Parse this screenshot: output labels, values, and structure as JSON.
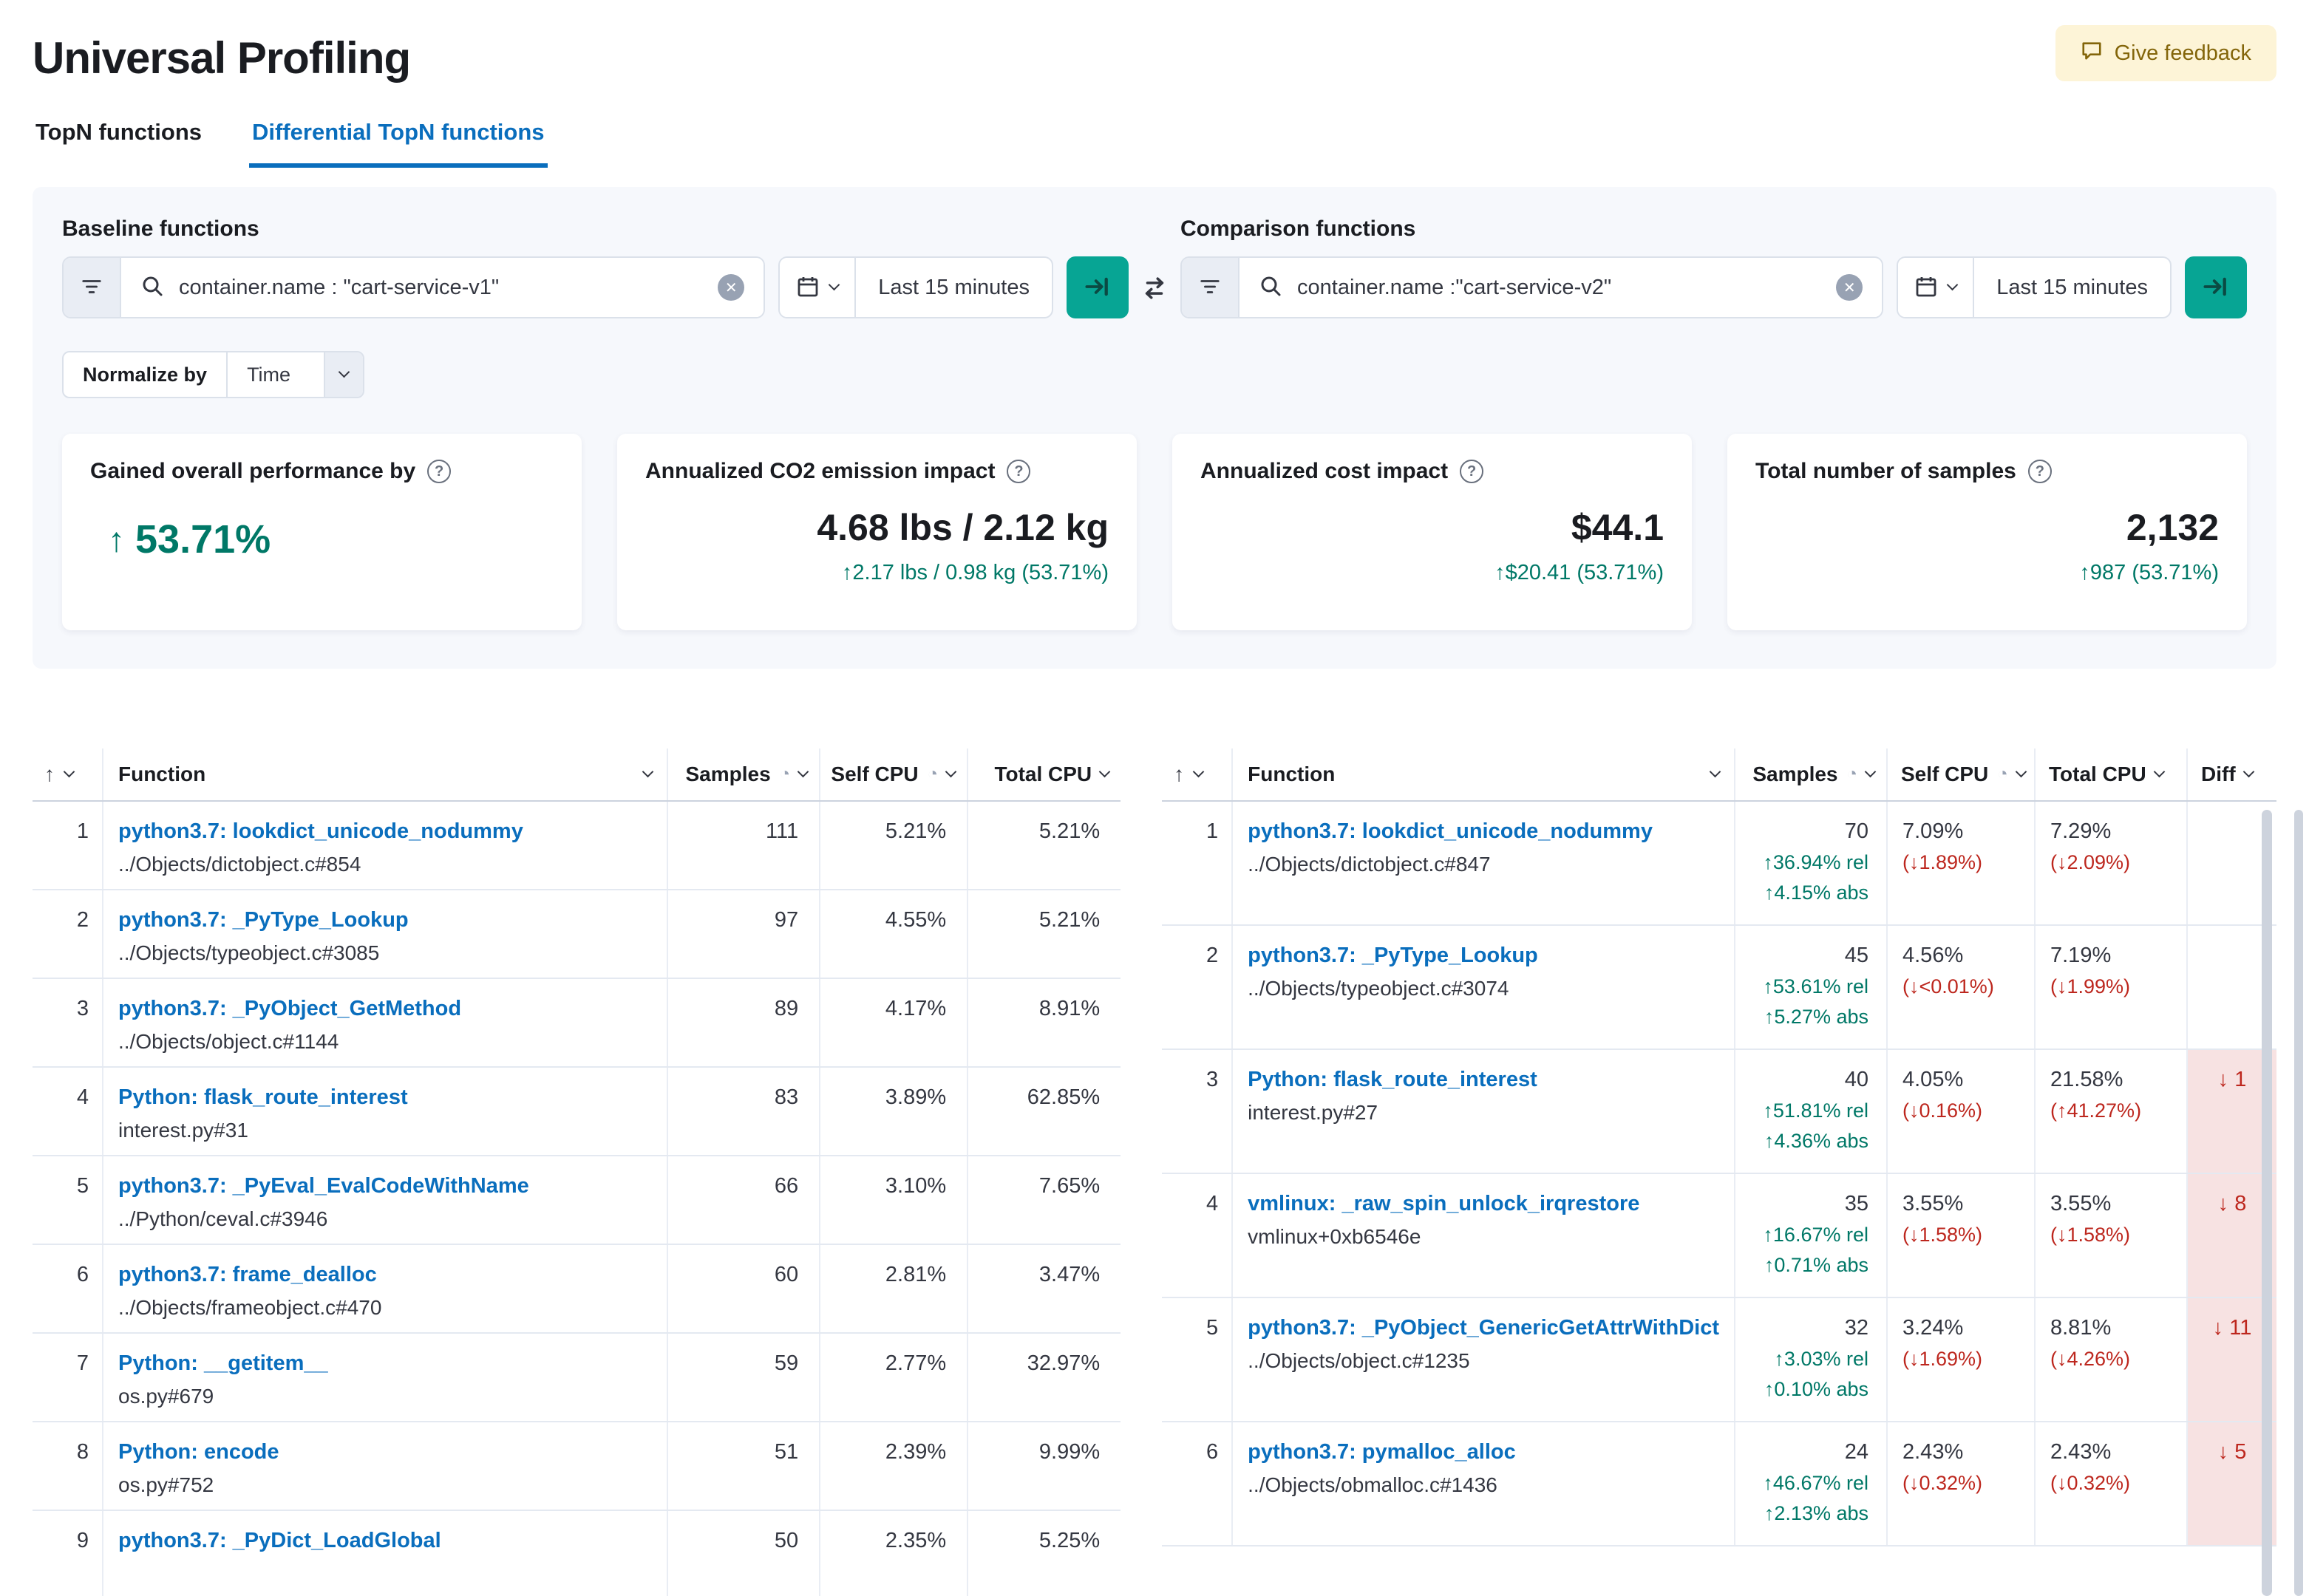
{
  "header": {
    "title": "Universal Profiling",
    "feedback_label": "Give feedback"
  },
  "tabs": [
    {
      "label": "TopN functions"
    },
    {
      "label": "Differential TopN functions"
    }
  ],
  "filters": {
    "baseline": {
      "label": "Baseline functions",
      "query": "container.name : \"cart-service-v1\"",
      "time_range": "Last 15 minutes"
    },
    "comparison": {
      "label": "Comparison functions",
      "query": "container.name :\"cart-service-v2\"",
      "time_range": "Last 15 minutes"
    }
  },
  "normalize": {
    "label": "Normalize by",
    "value": "Time"
  },
  "cards": [
    {
      "title": "Gained overall performance by",
      "arrow": "↑",
      "value": "53.71%"
    },
    {
      "title": "Annualized CO2 emission impact",
      "value": "4.68 lbs / 2.12 kg",
      "delta": "↑2.17 lbs / 0.98 kg (53.71%)"
    },
    {
      "title": "Annualized cost impact",
      "value": "$44.1",
      "delta": "↑$20.41 (53.71%)"
    },
    {
      "title": "Total number of samples",
      "value": "2,132",
      "delta": "↑987 (53.71%)"
    }
  ],
  "colors": {
    "accent_teal": "#07a594",
    "link_blue": "#0a6ebd",
    "success_green": "#007867",
    "danger_red": "#bd271e",
    "diff_pink": "#f7e2e2"
  },
  "baseline_table": {
    "headers": {
      "function": "Function",
      "samples": "Samples",
      "self_cpu": "Self CPU",
      "total_cpu": "Total CPU"
    },
    "rows": [
      {
        "rank": "1",
        "name": "python3.7: lookdict_unicode_nodummy",
        "location": "../Objects/dictobject.c#854",
        "samples": "111",
        "self_cpu": "5.21%",
        "total_cpu": "5.21%"
      },
      {
        "rank": "2",
        "name": "python3.7: _PyType_Lookup",
        "location": "../Objects/typeobject.c#3085",
        "samples": "97",
        "self_cpu": "4.55%",
        "total_cpu": "5.21%"
      },
      {
        "rank": "3",
        "name": "python3.7: _PyObject_GetMethod",
        "location": "../Objects/object.c#1144",
        "samples": "89",
        "self_cpu": "4.17%",
        "total_cpu": "8.91%"
      },
      {
        "rank": "4",
        "name": "Python: flask_route_interest",
        "location": "interest.py#31",
        "samples": "83",
        "self_cpu": "3.89%",
        "total_cpu": "62.85%"
      },
      {
        "rank": "5",
        "name": "python3.7: _PyEval_EvalCodeWithName",
        "location": "../Python/ceval.c#3946",
        "samples": "66",
        "self_cpu": "3.10%",
        "total_cpu": "7.65%"
      },
      {
        "rank": "6",
        "name": "python3.7: frame_dealloc",
        "location": "../Objects/frameobject.c#470",
        "samples": "60",
        "self_cpu": "2.81%",
        "total_cpu": "3.47%"
      },
      {
        "rank": "7",
        "name": "Python: __getitem__",
        "location": "os.py#679",
        "samples": "59",
        "self_cpu": "2.77%",
        "total_cpu": "32.97%"
      },
      {
        "rank": "8",
        "name": "Python: encode",
        "location": "os.py#752",
        "samples": "51",
        "self_cpu": "2.39%",
        "total_cpu": "9.99%"
      },
      {
        "rank": "9",
        "name": "python3.7: _PyDict_LoadGlobal",
        "location": "",
        "samples": "50",
        "self_cpu": "2.35%",
        "total_cpu": "5.25%"
      }
    ]
  },
  "comparison_table": {
    "headers": {
      "function": "Function",
      "samples": "Samples",
      "self_cpu": "Self CPU",
      "total_cpu": "Total CPU",
      "diff": "Diff"
    },
    "rows": [
      {
        "rank": "1",
        "name": "python3.7: lookdict_unicode_nodummy",
        "location": "../Objects/dictobject.c#847",
        "samples": "70",
        "samples_rel": "↑36.94% rel",
        "samples_abs": "↑4.15% abs",
        "self_cpu": "7.09%",
        "self_cpu_delta": "(↓1.89%)",
        "total_cpu": "7.29%",
        "total_cpu_delta": "(↓2.09%)",
        "diff": ""
      },
      {
        "rank": "2",
        "name": "python3.7: _PyType_Lookup",
        "location": "../Objects/typeobject.c#3074",
        "samples": "45",
        "samples_rel": "↑53.61% rel",
        "samples_abs": "↑5.27% abs",
        "self_cpu": "4.56%",
        "self_cpu_delta": "(↓<0.01%)",
        "total_cpu": "7.19%",
        "total_cpu_delta": "(↓1.99%)",
        "diff": ""
      },
      {
        "rank": "3",
        "name": "Python: flask_route_interest",
        "location": "interest.py#27",
        "samples": "40",
        "samples_rel": "↑51.81% rel",
        "samples_abs": "↑4.36% abs",
        "self_cpu": "4.05%",
        "self_cpu_delta": "(↓0.16%)",
        "total_cpu": "21.58%",
        "total_cpu_delta": "(↑41.27%)",
        "diff": "↓ 1"
      },
      {
        "rank": "4",
        "name": "vmlinux: _raw_spin_unlock_irqrestore",
        "location": "vmlinux+0xb6546e",
        "samples": "35",
        "samples_rel": "↑16.67% rel",
        "samples_abs": "↑0.71% abs",
        "self_cpu": "3.55%",
        "self_cpu_delta": "(↓1.58%)",
        "total_cpu": "3.55%",
        "total_cpu_delta": "(↓1.58%)",
        "diff": "↓ 8"
      },
      {
        "rank": "5",
        "name": "python3.7: _PyObject_GenericGetAttrWithDict",
        "location": "../Objects/object.c#1235",
        "samples": "32",
        "samples_rel": "↑3.03% rel",
        "samples_abs": "↑0.10% abs",
        "self_cpu": "3.24%",
        "self_cpu_delta": "(↓1.69%)",
        "total_cpu": "8.81%",
        "total_cpu_delta": "(↓4.26%)",
        "diff": "↓ 11"
      },
      {
        "rank": "6",
        "name": "python3.7: pymalloc_alloc",
        "location": "../Objects/obmalloc.c#1436",
        "samples": "24",
        "samples_rel": "↑46.67% rel",
        "samples_abs": "↑2.13% abs",
        "self_cpu": "2.43%",
        "self_cpu_delta": "(↓0.32%)",
        "total_cpu": "2.43%",
        "total_cpu_delta": "(↓0.32%)",
        "diff": "↓ 5"
      }
    ]
  }
}
